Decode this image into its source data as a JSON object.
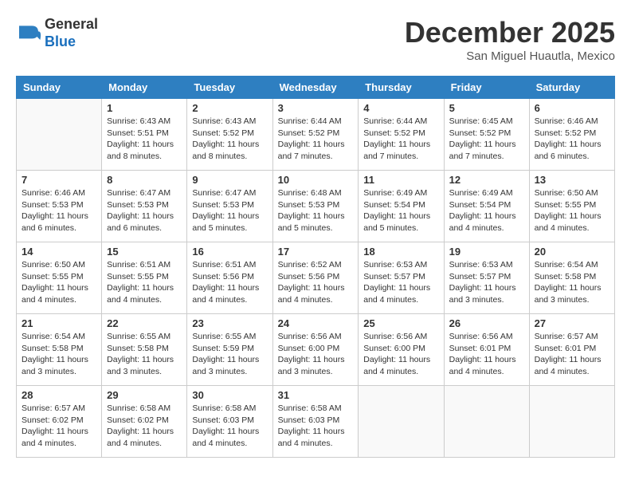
{
  "header": {
    "logo_line1": "General",
    "logo_line2": "Blue",
    "month_title": "December 2025",
    "location": "San Miguel Huautla, Mexico"
  },
  "weekdays": [
    "Sunday",
    "Monday",
    "Tuesday",
    "Wednesday",
    "Thursday",
    "Friday",
    "Saturday"
  ],
  "weeks": [
    [
      {
        "day": "",
        "content": ""
      },
      {
        "day": "1",
        "content": "Sunrise: 6:43 AM\nSunset: 5:51 PM\nDaylight: 11 hours\nand 8 minutes."
      },
      {
        "day": "2",
        "content": "Sunrise: 6:43 AM\nSunset: 5:52 PM\nDaylight: 11 hours\nand 8 minutes."
      },
      {
        "day": "3",
        "content": "Sunrise: 6:44 AM\nSunset: 5:52 PM\nDaylight: 11 hours\nand 7 minutes."
      },
      {
        "day": "4",
        "content": "Sunrise: 6:44 AM\nSunset: 5:52 PM\nDaylight: 11 hours\nand 7 minutes."
      },
      {
        "day": "5",
        "content": "Sunrise: 6:45 AM\nSunset: 5:52 PM\nDaylight: 11 hours\nand 7 minutes."
      },
      {
        "day": "6",
        "content": "Sunrise: 6:46 AM\nSunset: 5:52 PM\nDaylight: 11 hours\nand 6 minutes."
      }
    ],
    [
      {
        "day": "7",
        "content": "Sunrise: 6:46 AM\nSunset: 5:53 PM\nDaylight: 11 hours\nand 6 minutes."
      },
      {
        "day": "8",
        "content": "Sunrise: 6:47 AM\nSunset: 5:53 PM\nDaylight: 11 hours\nand 6 minutes."
      },
      {
        "day": "9",
        "content": "Sunrise: 6:47 AM\nSunset: 5:53 PM\nDaylight: 11 hours\nand 5 minutes."
      },
      {
        "day": "10",
        "content": "Sunrise: 6:48 AM\nSunset: 5:53 PM\nDaylight: 11 hours\nand 5 minutes."
      },
      {
        "day": "11",
        "content": "Sunrise: 6:49 AM\nSunset: 5:54 PM\nDaylight: 11 hours\nand 5 minutes."
      },
      {
        "day": "12",
        "content": "Sunrise: 6:49 AM\nSunset: 5:54 PM\nDaylight: 11 hours\nand 4 minutes."
      },
      {
        "day": "13",
        "content": "Sunrise: 6:50 AM\nSunset: 5:55 PM\nDaylight: 11 hours\nand 4 minutes."
      }
    ],
    [
      {
        "day": "14",
        "content": "Sunrise: 6:50 AM\nSunset: 5:55 PM\nDaylight: 11 hours\nand 4 minutes."
      },
      {
        "day": "15",
        "content": "Sunrise: 6:51 AM\nSunset: 5:55 PM\nDaylight: 11 hours\nand 4 minutes."
      },
      {
        "day": "16",
        "content": "Sunrise: 6:51 AM\nSunset: 5:56 PM\nDaylight: 11 hours\nand 4 minutes."
      },
      {
        "day": "17",
        "content": "Sunrise: 6:52 AM\nSunset: 5:56 PM\nDaylight: 11 hours\nand 4 minutes."
      },
      {
        "day": "18",
        "content": "Sunrise: 6:53 AM\nSunset: 5:57 PM\nDaylight: 11 hours\nand 4 minutes."
      },
      {
        "day": "19",
        "content": "Sunrise: 6:53 AM\nSunset: 5:57 PM\nDaylight: 11 hours\nand 3 minutes."
      },
      {
        "day": "20",
        "content": "Sunrise: 6:54 AM\nSunset: 5:58 PM\nDaylight: 11 hours\nand 3 minutes."
      }
    ],
    [
      {
        "day": "21",
        "content": "Sunrise: 6:54 AM\nSunset: 5:58 PM\nDaylight: 11 hours\nand 3 minutes."
      },
      {
        "day": "22",
        "content": "Sunrise: 6:55 AM\nSunset: 5:58 PM\nDaylight: 11 hours\nand 3 minutes."
      },
      {
        "day": "23",
        "content": "Sunrise: 6:55 AM\nSunset: 5:59 PM\nDaylight: 11 hours\nand 3 minutes."
      },
      {
        "day": "24",
        "content": "Sunrise: 6:56 AM\nSunset: 6:00 PM\nDaylight: 11 hours\nand 3 minutes."
      },
      {
        "day": "25",
        "content": "Sunrise: 6:56 AM\nSunset: 6:00 PM\nDaylight: 11 hours\nand 4 minutes."
      },
      {
        "day": "26",
        "content": "Sunrise: 6:56 AM\nSunset: 6:01 PM\nDaylight: 11 hours\nand 4 minutes."
      },
      {
        "day": "27",
        "content": "Sunrise: 6:57 AM\nSunset: 6:01 PM\nDaylight: 11 hours\nand 4 minutes."
      }
    ],
    [
      {
        "day": "28",
        "content": "Sunrise: 6:57 AM\nSunset: 6:02 PM\nDaylight: 11 hours\nand 4 minutes."
      },
      {
        "day": "29",
        "content": "Sunrise: 6:58 AM\nSunset: 6:02 PM\nDaylight: 11 hours\nand 4 minutes."
      },
      {
        "day": "30",
        "content": "Sunrise: 6:58 AM\nSunset: 6:03 PM\nDaylight: 11 hours\nand 4 minutes."
      },
      {
        "day": "31",
        "content": "Sunrise: 6:58 AM\nSunset: 6:03 PM\nDaylight: 11 hours\nand 4 minutes."
      },
      {
        "day": "",
        "content": ""
      },
      {
        "day": "",
        "content": ""
      },
      {
        "day": "",
        "content": ""
      }
    ]
  ]
}
